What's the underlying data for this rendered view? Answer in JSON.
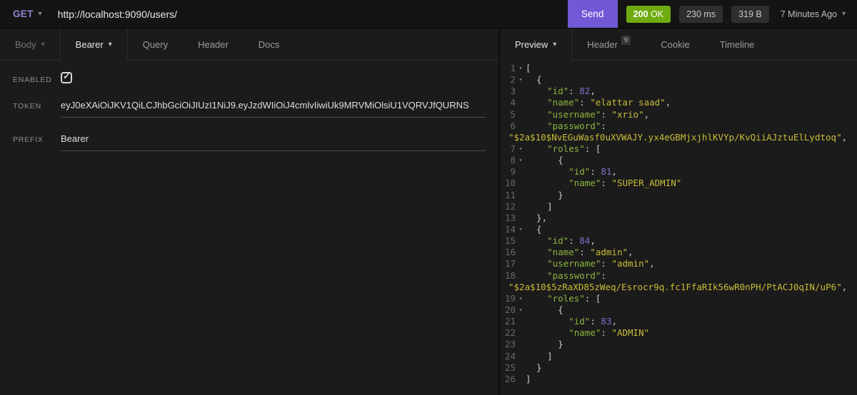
{
  "icons": {
    "chevron_down": "▾",
    "check": "✓"
  },
  "request_bar": {
    "method": "GET",
    "url": "http://localhost:9090/users/",
    "send_label": "Send",
    "status_code": "200",
    "status_text": "OK",
    "time": "230 ms",
    "size": "319 B",
    "history": "7 Minutes Ago"
  },
  "request_tabs": {
    "body": "Body",
    "auth": "Bearer",
    "query": "Query",
    "header": "Header",
    "docs": "Docs"
  },
  "auth_panel": {
    "enabled_label": "ENABLED",
    "token_label": "TOKEN",
    "token_value": "eyJ0eXAiOiJKV1QiLCJhbGciOiJIUzI1NiJ9.eyJzdWIiOiJ4cmlvIiwiUk9MRVMiOlsiU1VQRVJfQURNS",
    "prefix_label": "PREFIX",
    "prefix_value": "Bearer"
  },
  "response_tabs": {
    "preview": "Preview",
    "header": "Header",
    "header_count": "9",
    "cookie": "Cookie",
    "timeline": "Timeline"
  },
  "code": {
    "rows": [
      {
        "n": "1",
        "a": true,
        "segs": [
          [
            "p",
            "["
          ]
        ]
      },
      {
        "n": "2",
        "a": true,
        "segs": [
          [
            "p",
            "  {"
          ]
        ]
      },
      {
        "n": "3",
        "segs": [
          [
            "p",
            "    "
          ],
          [
            "k",
            "\"id\""
          ],
          [
            "p",
            ": "
          ],
          [
            "n",
            "82"
          ],
          [
            "p",
            ","
          ]
        ]
      },
      {
        "n": "4",
        "segs": [
          [
            "p",
            "    "
          ],
          [
            "k",
            "\"name\""
          ],
          [
            "p",
            ": "
          ],
          [
            "s",
            "\"elattar saad\""
          ],
          [
            "p",
            ","
          ]
        ]
      },
      {
        "n": "5",
        "segs": [
          [
            "p",
            "    "
          ],
          [
            "k",
            "\"username\""
          ],
          [
            "p",
            ": "
          ],
          [
            "s",
            "\"xrio\""
          ],
          [
            "p",
            ","
          ]
        ]
      },
      {
        "n": "6",
        "segs": [
          [
            "p",
            "    "
          ],
          [
            "k",
            "\"password\""
          ],
          [
            "p",
            ":"
          ]
        ]
      },
      {
        "wrap": true,
        "segs": [
          [
            "s",
            "\"$2a$10$NvEGuWasf0uXVWAJY.yx4eGBMjxjhlKVYp/KvQiiAJztuElLydtoq\""
          ],
          [
            "p",
            ","
          ]
        ]
      },
      {
        "n": "7",
        "a": true,
        "segs": [
          [
            "p",
            "    "
          ],
          [
            "k",
            "\"roles\""
          ],
          [
            "p",
            ": ["
          ]
        ]
      },
      {
        "n": "8",
        "a": true,
        "segs": [
          [
            "p",
            "      {"
          ]
        ]
      },
      {
        "n": "9",
        "segs": [
          [
            "p",
            "        "
          ],
          [
            "k",
            "\"id\""
          ],
          [
            "p",
            ": "
          ],
          [
            "n",
            "81"
          ],
          [
            "p",
            ","
          ]
        ]
      },
      {
        "n": "10",
        "segs": [
          [
            "p",
            "        "
          ],
          [
            "k",
            "\"name\""
          ],
          [
            "p",
            ": "
          ],
          [
            "s",
            "\"SUPER_ADMIN\""
          ]
        ]
      },
      {
        "n": "11",
        "segs": [
          [
            "p",
            "      }"
          ]
        ]
      },
      {
        "n": "12",
        "segs": [
          [
            "p",
            "    ]"
          ]
        ]
      },
      {
        "n": "13",
        "segs": [
          [
            "p",
            "  },"
          ]
        ]
      },
      {
        "n": "14",
        "a": true,
        "segs": [
          [
            "p",
            "  {"
          ]
        ]
      },
      {
        "n": "15",
        "segs": [
          [
            "p",
            "    "
          ],
          [
            "k",
            "\"id\""
          ],
          [
            "p",
            ": "
          ],
          [
            "n",
            "84"
          ],
          [
            "p",
            ","
          ]
        ]
      },
      {
        "n": "16",
        "segs": [
          [
            "p",
            "    "
          ],
          [
            "k",
            "\"name\""
          ],
          [
            "p",
            ": "
          ],
          [
            "s",
            "\"admin\""
          ],
          [
            "p",
            ","
          ]
        ]
      },
      {
        "n": "17",
        "segs": [
          [
            "p",
            "    "
          ],
          [
            "k",
            "\"username\""
          ],
          [
            "p",
            ": "
          ],
          [
            "s",
            "\"admin\""
          ],
          [
            "p",
            ","
          ]
        ]
      },
      {
        "n": "18",
        "segs": [
          [
            "p",
            "    "
          ],
          [
            "k",
            "\"password\""
          ],
          [
            "p",
            ":"
          ]
        ]
      },
      {
        "wrap": true,
        "segs": [
          [
            "s",
            "\"$2a$10$5zRaXD85zWeq/Esrocr9q.fc1FfaRIk56wR0nPH/PtACJ0qIN/uP6\""
          ],
          [
            "p",
            ","
          ]
        ]
      },
      {
        "n": "19",
        "a": true,
        "segs": [
          [
            "p",
            "    "
          ],
          [
            "k",
            "\"roles\""
          ],
          [
            "p",
            ": ["
          ]
        ]
      },
      {
        "n": "20",
        "a": true,
        "segs": [
          [
            "p",
            "      {"
          ]
        ]
      },
      {
        "n": "21",
        "segs": [
          [
            "p",
            "        "
          ],
          [
            "k",
            "\"id\""
          ],
          [
            "p",
            ": "
          ],
          [
            "n",
            "83"
          ],
          [
            "p",
            ","
          ]
        ]
      },
      {
        "n": "22",
        "segs": [
          [
            "p",
            "        "
          ],
          [
            "k",
            "\"name\""
          ],
          [
            "p",
            ": "
          ],
          [
            "s",
            "\"ADMIN\""
          ]
        ]
      },
      {
        "n": "23",
        "segs": [
          [
            "p",
            "      }"
          ]
        ]
      },
      {
        "n": "24",
        "segs": [
          [
            "p",
            "    ]"
          ]
        ]
      },
      {
        "n": "25",
        "segs": [
          [
            "p",
            "  }"
          ]
        ]
      },
      {
        "n": "26",
        "segs": [
          [
            "p",
            "]"
          ]
        ]
      }
    ]
  }
}
